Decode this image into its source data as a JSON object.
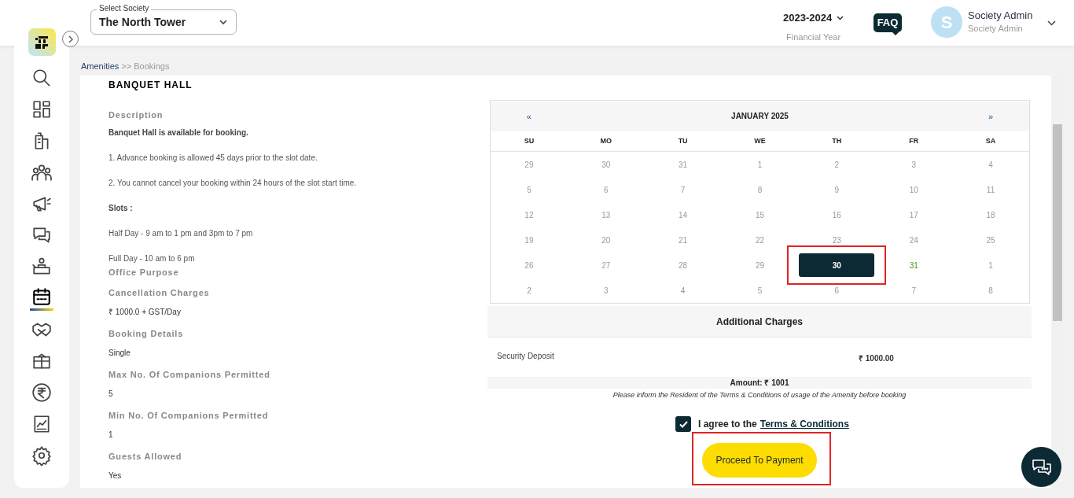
{
  "header": {
    "society_label": "Select Society",
    "society": "The North Tower",
    "year": "2023-2024",
    "year_label": "Financial Year",
    "faq": "FAQ",
    "avatar_letter": "S",
    "user_name": "Society Admin",
    "user_role": "Society Admin"
  },
  "sidebar": {
    "items": [
      {
        "selected": false
      },
      {
        "selected": false
      },
      {
        "selected": false
      },
      {
        "selected": false
      },
      {
        "selected": false
      },
      {
        "selected": false
      },
      {
        "selected": false
      },
      {
        "selected": true
      },
      {
        "selected": false
      },
      {
        "selected": false
      },
      {
        "selected": false
      },
      {
        "selected": false
      },
      {
        "selected": false
      }
    ]
  },
  "breadcrumb": [
    "Amenities",
    ">> Bookings"
  ],
  "amenity": {
    "title": "BANQUET HALL",
    "description_heading": "Description",
    "description": [
      {
        "kind": "bold",
        "text": "Banquet Hall is available for booking."
      },
      {
        "kind": "plain",
        "text": "1. Advance booking is allowed 45 days prior to the slot date."
      },
      {
        "kind": "plain",
        "text": "2. You cannot cancel your booking within 24 hours of the slot start time."
      },
      {
        "kind": "bold",
        "text": "Slots :"
      },
      {
        "kind": "plain",
        "text": "Half Day - 9 am to 1 pm and 3pm to 7 pm"
      },
      {
        "kind": "plain",
        "text": "Full Day - 10 am to 6 pm"
      }
    ],
    "details": [
      {
        "heading": "Office Purpose"
      },
      {
        "heading": "Cancellation Charges",
        "value": "₹ 1000.0 + GST/Day"
      },
      {
        "heading": "Booking Details",
        "value": "Single"
      },
      {
        "heading": "Max No. Of Companions Permitted",
        "value": "5"
      },
      {
        "heading": "Min No. Of Companions Permitted",
        "value": "1"
      },
      {
        "heading": "Guests Allowed",
        "value": "Yes"
      }
    ]
  },
  "calendar": {
    "prev": "«",
    "month": "JANUARY 2025",
    "next": "»",
    "weekdays": [
      "SU",
      "MO",
      "TU",
      "WE",
      "TH",
      "FR",
      "SA"
    ],
    "weeks": [
      [
        {
          "day": "29",
          "selected": false,
          "today": false
        },
        {
          "day": "30",
          "selected": false,
          "today": false
        },
        {
          "day": "31",
          "selected": false,
          "today": false
        },
        {
          "day": "1",
          "selected": false,
          "today": false
        },
        {
          "day": "2",
          "selected": false,
          "today": false
        },
        {
          "day": "3",
          "selected": false,
          "today": false
        },
        {
          "day": "4",
          "selected": false,
          "today": false
        }
      ],
      [
        {
          "day": "5",
          "selected": false,
          "today": false
        },
        {
          "day": "6",
          "selected": false,
          "today": false
        },
        {
          "day": "7",
          "selected": false,
          "today": false
        },
        {
          "day": "8",
          "selected": false,
          "today": false
        },
        {
          "day": "9",
          "selected": false,
          "today": false
        },
        {
          "day": "10",
          "selected": false,
          "today": false
        },
        {
          "day": "11",
          "selected": false,
          "today": false
        }
      ],
      [
        {
          "day": "12",
          "selected": false,
          "today": false
        },
        {
          "day": "13",
          "selected": false,
          "today": false
        },
        {
          "day": "14",
          "selected": false,
          "today": false
        },
        {
          "day": "15",
          "selected": false,
          "today": false
        },
        {
          "day": "16",
          "selected": false,
          "today": false
        },
        {
          "day": "17",
          "selected": false,
          "today": false
        },
        {
          "day": "18",
          "selected": false,
          "today": false
        }
      ],
      [
        {
          "day": "19",
          "selected": false,
          "today": false
        },
        {
          "day": "20",
          "selected": false,
          "today": false
        },
        {
          "day": "21",
          "selected": false,
          "today": false
        },
        {
          "day": "22",
          "selected": false,
          "today": false
        },
        {
          "day": "23",
          "selected": false,
          "today": false
        },
        {
          "day": "24",
          "selected": false,
          "today": false
        },
        {
          "day": "25",
          "selected": false,
          "today": false
        }
      ],
      [
        {
          "day": "26",
          "selected": false,
          "today": false
        },
        {
          "day": "27",
          "selected": false,
          "today": false
        },
        {
          "day": "28",
          "selected": false,
          "today": false
        },
        {
          "day": "29",
          "selected": false,
          "today": false
        },
        {
          "day": "30",
          "selected": true,
          "today": false,
          "outlined": true
        },
        {
          "day": "31",
          "selected": false,
          "today": true
        },
        {
          "day": "1",
          "selected": false,
          "today": false
        }
      ],
      [
        {
          "day": "2",
          "selected": false,
          "today": false
        },
        {
          "day": "3",
          "selected": false,
          "today": false
        },
        {
          "day": "4",
          "selected": false,
          "today": false
        },
        {
          "day": "5",
          "selected": false,
          "today": false
        },
        {
          "day": "6",
          "selected": false,
          "today": false
        },
        {
          "day": "7",
          "selected": false,
          "today": false
        },
        {
          "day": "8",
          "selected": false,
          "today": false
        }
      ]
    ]
  },
  "charges": {
    "heading": "Additional Charges",
    "rows": [
      {
        "name": "Security Deposit",
        "amount": "₹ 1000.00"
      }
    ],
    "total": "Amount: ₹ 1001",
    "note": "Please inform the Resident of the Terms & Conditions of usage of the Amenity before booking"
  },
  "agreement": {
    "checked": true,
    "text": "I agree to the",
    "link": "Terms & Conditions"
  },
  "proceed_button": {
    "label": "Proceed To Payment",
    "outlined": true
  }
}
